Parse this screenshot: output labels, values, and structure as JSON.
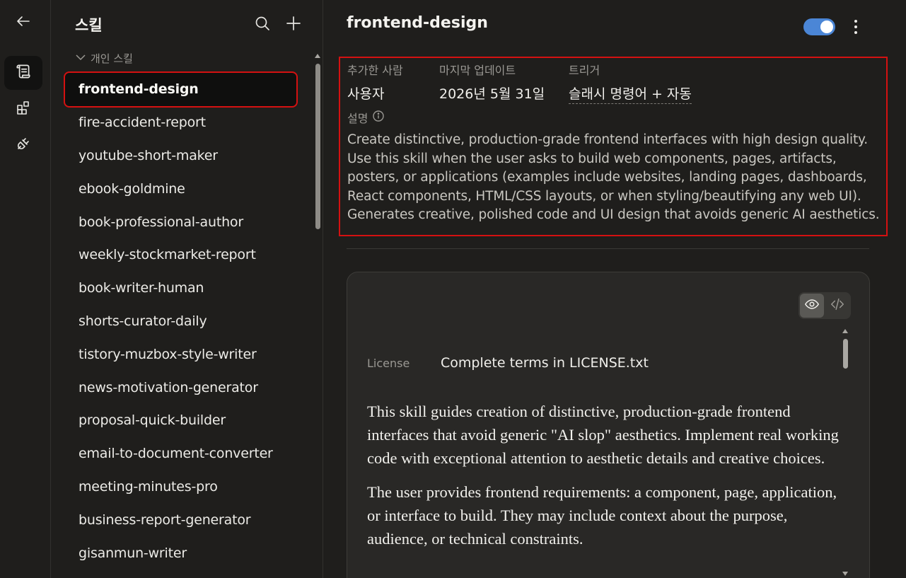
{
  "rail": {
    "icons": [
      "back-arrow-icon",
      "skills-scroll-icon",
      "connectors-icon",
      "plugin-icon"
    ]
  },
  "skills_panel": {
    "title": "스킬",
    "group_label": "개인 스킬",
    "items": [
      "frontend-design",
      "fire-accident-report",
      "youtube-short-maker",
      "ebook-goldmine",
      "book-professional-author",
      "weekly-stockmarket-report",
      "book-writer-human",
      "shorts-curator-daily",
      "tistory-muzbox-style-writer",
      "news-motivation-generator",
      "proposal-quick-builder",
      "email-to-document-converter",
      "meeting-minutes-pro",
      "business-report-generator",
      "gisanmun-writer"
    ],
    "selected_index": 0
  },
  "detail": {
    "title": "frontend-design",
    "enabled": true,
    "meta": {
      "added_by_label": "추가한 사람",
      "added_by_value": "사용자",
      "updated_label": "마지막 업데이트",
      "updated_value": "2026년 5월 31일",
      "trigger_label": "트리거",
      "trigger_value": "슬래시 명령어 + 자동"
    },
    "description_label": "설명",
    "description": "Create distinctive, production-grade frontend interfaces with high design quality. Use this skill when the user asks to build web components, pages, artifacts, posters, or applications (examples include websites, landing pages, dashboards, React components, HTML/CSS layouts, or when styling/beautifying any web UI). Generates creative, polished code and UI design that avoids generic AI aesthetics.",
    "content": {
      "view_mode": "preview",
      "license_label": "License",
      "license_value": "Complete terms in LICENSE.txt",
      "paragraphs": [
        "This skill guides creation of distinctive, production-grade frontend interfaces that avoid generic \"AI slop\" aesthetics. Implement real working code with exceptional attention to aesthetic details and creative choices.",
        "The user provides frontend requirements: a component, page, application, or interface to build. They may include context about the purpose, audience, or technical constraints."
      ]
    }
  },
  "colors": {
    "background": "#1f1e1c",
    "card": "#292826",
    "toggle_on": "#4b86d6",
    "highlight_border": "#d41111"
  }
}
